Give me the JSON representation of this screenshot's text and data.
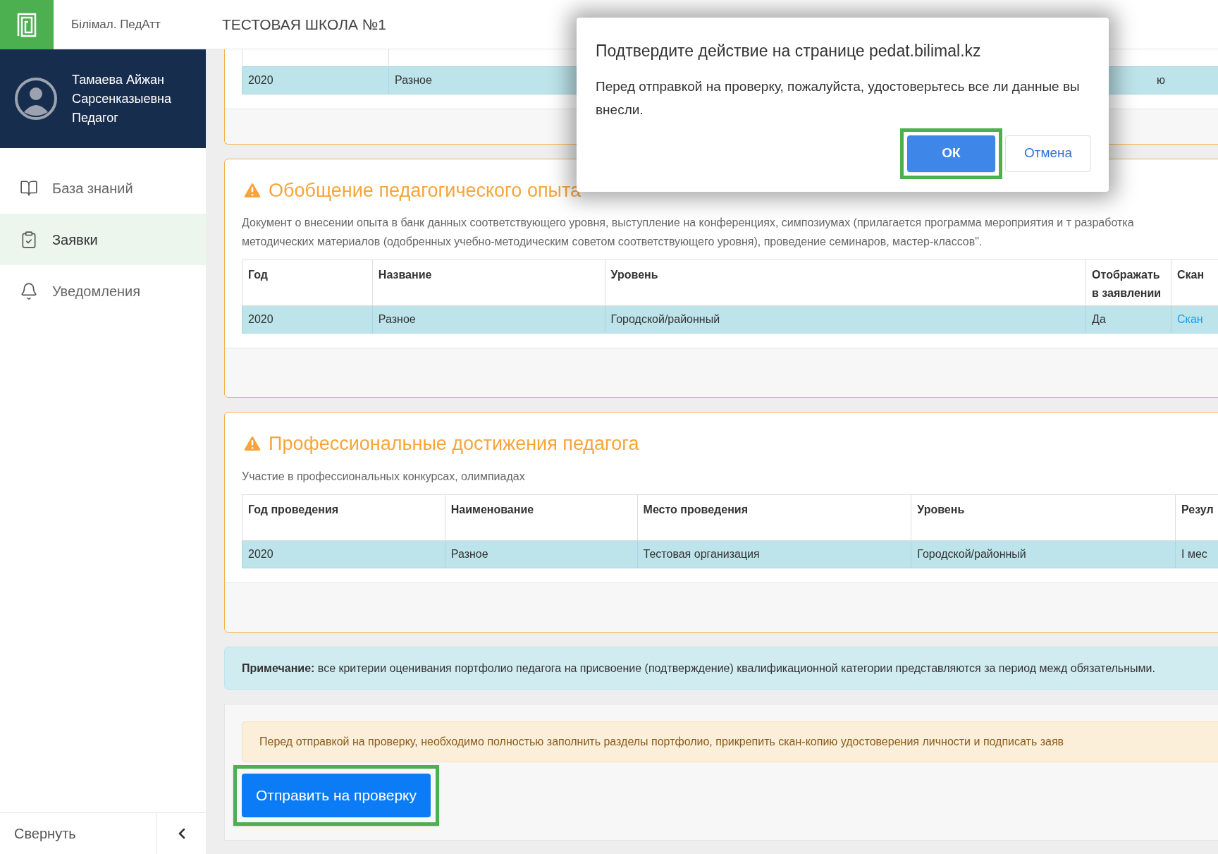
{
  "header": {
    "app_name": "Білімал. ПедАтт",
    "school": "ТЕСТОВАЯ ШКОЛА №1"
  },
  "profile": {
    "name_line_1": "Тамаева Айжан",
    "name_line_2": "Сарсенказыевна",
    "role": "Педагог"
  },
  "sidebar": {
    "items": [
      {
        "kind": "book",
        "label": "База знаний",
        "selected": false
      },
      {
        "kind": "clipboard",
        "label": "Заявки",
        "selected": true
      },
      {
        "kind": "bell",
        "label": "Уведомления",
        "selected": false
      }
    ],
    "collapse": "Свернуть"
  },
  "top_table": {
    "rows": [
      [
        "2020",
        "Разное",
        "ю"
      ]
    ]
  },
  "sections": [
    {
      "title": "Обобщение педагогического опыта",
      "description": "Документ о внесении опыта в банк данных соответствующего уровня, выступление на конференциях, симпозиумах (прилагается программа мероприятия и т разработка методических материалов (одобренных учебно-методическим советом соответствующего уровня), проведение семинаров, мастер-классов\".",
      "columns": [
        "Год",
        "Название",
        "Уровень",
        "Отображать в заявлении",
        "Скан"
      ],
      "rows": [
        [
          {
            "text": "2020",
            "kind": "text"
          },
          {
            "text": "Разное",
            "kind": "text"
          },
          {
            "text": "Городской/районный",
            "kind": "text"
          },
          {
            "text": "Да",
            "kind": "text"
          },
          {
            "text": "Скан",
            "kind": "link"
          }
        ]
      ]
    },
    {
      "title": "Профессиональные достижения педагога",
      "description": "Участие в профессиональных конкурсах, олимпиадах",
      "columns": [
        "Год проведения",
        "Наименование",
        "Место проведения",
        "Уровень",
        "Резул"
      ],
      "rows": [
        [
          {
            "text": "2020",
            "kind": "text"
          },
          {
            "text": "Разное",
            "kind": "text"
          },
          {
            "text": "Тестовая организация",
            "kind": "text"
          },
          {
            "text": "Городской/районный",
            "kind": "text"
          },
          {
            "text": "I мес",
            "kind": "text"
          }
        ]
      ]
    }
  ],
  "note": "**Примечание:** все критерии оценивания портфолио педагога на присвоение (подтверждение) квалификационной категории представляются за период межд обязательными.",
  "warning": "Перед отправкой на проверку, необходимо полностью заполнить разделы портфолио, прикрепить скан-копию удостоверения личности и подписать заяв",
  "submit_button": "Отправить на проверку",
  "dialog": {
    "title": "Подтвердите действие на странице pedat.bilimal.kz",
    "message": "Перед отправкой на проверку, пожалуйста, удостоверьтесь все ли данные вы внесли.",
    "ok": "ОК",
    "cancel": "Отмена"
  }
}
